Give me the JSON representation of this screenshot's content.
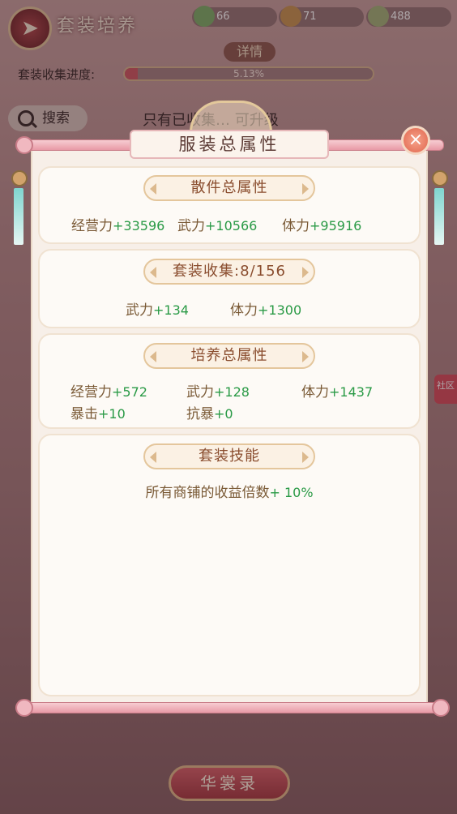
{
  "screen": {
    "title": "套装培养",
    "resources": [
      {
        "icon": "jade-icon",
        "value": "66"
      },
      {
        "icon": "gift-bag-icon",
        "value": "71"
      },
      {
        "icon": "coin-icon",
        "value": "488"
      }
    ],
    "detail_label": "详情",
    "progress": {
      "label": "套装收集进度:",
      "text": "5.13%",
      "fraction": 0.0513
    },
    "search_label": "搜索",
    "hint_text": "只有已收集… 可升级",
    "side_tab": "社区",
    "bottom_button": "华裳录"
  },
  "dialog": {
    "title": "服装总属性",
    "close_label": "×",
    "sections": [
      {
        "title": "散件总属性",
        "stats": [
          {
            "name": "经营力",
            "value": "+33596"
          },
          {
            "name": "武力",
            "value": "+10566"
          },
          {
            "name": "体力",
            "value": "+95916"
          }
        ]
      },
      {
        "title": "套装收集:8/156",
        "stats": [
          {
            "name": "武力",
            "value": "+134"
          },
          {
            "name": "体力",
            "value": "+1300"
          }
        ]
      },
      {
        "title": "培养总属性",
        "stats": [
          {
            "name": "经营力",
            "value": "+572"
          },
          {
            "name": "武力",
            "value": "+128"
          },
          {
            "name": "体力",
            "value": "+1437"
          },
          {
            "name": "暴击",
            "value": "+10"
          },
          {
            "name": "抗暴",
            "value": "+0"
          }
        ]
      },
      {
        "title": "套装技能",
        "skill": {
          "text": "所有商铺的收益倍数",
          "value": "+ 10%"
        }
      }
    ]
  }
}
